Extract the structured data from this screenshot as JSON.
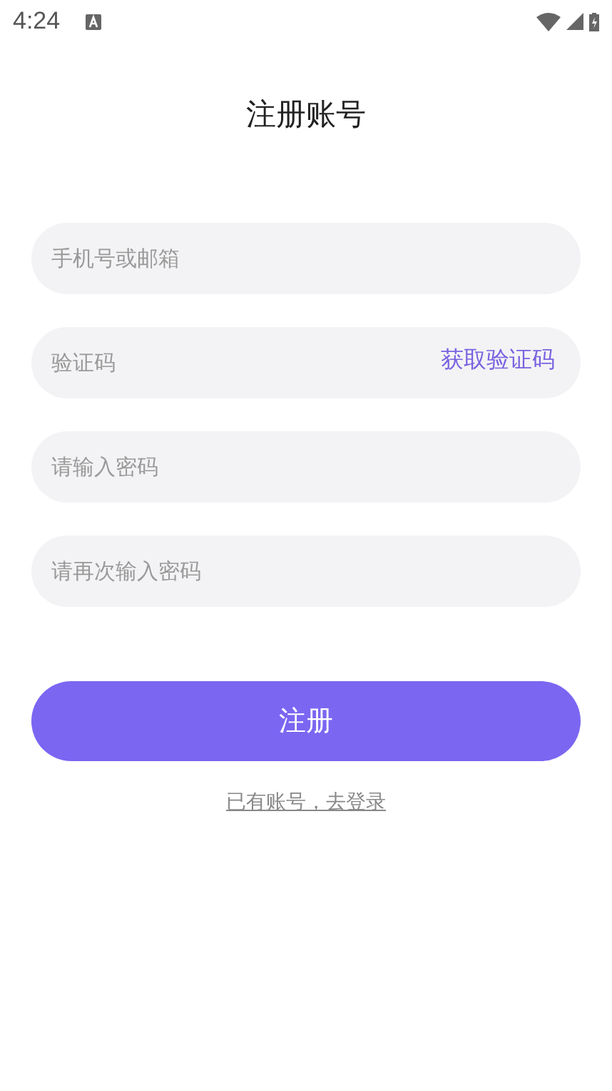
{
  "status_bar": {
    "time": "4:24"
  },
  "title": "注册账号",
  "fields": [
    {
      "placeholder": "手机号或邮箱"
    },
    {
      "placeholder": "验证码",
      "action": "获取验证码"
    },
    {
      "placeholder": "请输入密码"
    },
    {
      "placeholder": "请再次输入密码"
    }
  ],
  "submit": "注册",
  "login_link": "已有账号，去登录"
}
